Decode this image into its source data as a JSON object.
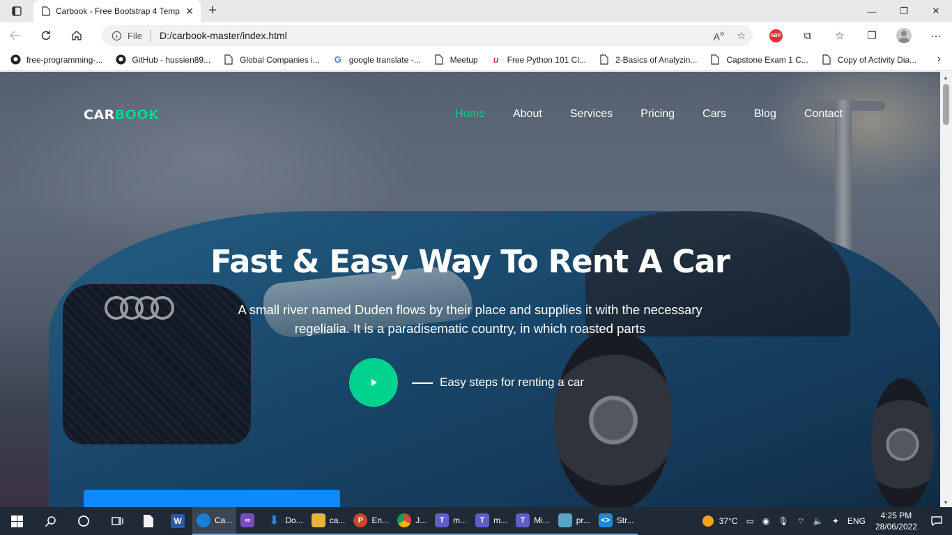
{
  "browser": {
    "tab": {
      "title": "Carbook - Free Bootstrap 4 Temp",
      "close": "✕"
    },
    "new_tab": "+",
    "window_controls": {
      "minimize": "—",
      "maximize": "❐",
      "close": "✕"
    },
    "address": {
      "scheme_label": "File",
      "url": "D:/carbook-master/index.html"
    },
    "bookmarks": [
      {
        "label": "free-programming-...",
        "icon": "github-icon"
      },
      {
        "label": "GitHub - hussien89...",
        "icon": "github-icon"
      },
      {
        "label": "Global Companies i...",
        "icon": "page-icon"
      },
      {
        "label": "google translate -...",
        "icon": "google-icon"
      },
      {
        "label": "Meetup",
        "icon": "page-icon"
      },
      {
        "label": "Free Python 101 Cl...",
        "icon": "udemy-icon"
      },
      {
        "label": "2-Basics of Analyzin...",
        "icon": "page-icon"
      },
      {
        "label": "Capstone Exam 1 C...",
        "icon": "page-icon"
      },
      {
        "label": "Copy of Activity Dia...",
        "icon": "page-icon"
      }
    ]
  },
  "site": {
    "logo": {
      "part1": "CAR",
      "part2": "BOOK"
    },
    "menu": [
      "Home",
      "About",
      "Services",
      "Pricing",
      "Cars",
      "Blog",
      "Contact"
    ],
    "active_menu": "Home",
    "hero": {
      "title": "Fast & Easy Way To Rent A Car",
      "text": "A small river named Duden flows by their place and supplies it with the necessary regelialia. It is a paradisematic country, in which roasted parts",
      "steps_label": "Easy steps for renting a car"
    },
    "colors": {
      "accent": "#01d28e",
      "booking_bar": "#1089ff"
    }
  },
  "taskbar": {
    "apps": [
      {
        "label": "Ca...",
        "icon": "edge-icon",
        "color": "#1c7fd6",
        "active": true
      },
      {
        "label": "",
        "icon": "visual-studio-icon",
        "color": "#7b4bbd",
        "active": false
      },
      {
        "label": "Do...",
        "icon": "download-icon",
        "color": "#2a8ad8",
        "active": false
      },
      {
        "label": "ca...",
        "icon": "folder-icon",
        "color": "#e7b53b",
        "active": false
      },
      {
        "label": "En...",
        "icon": "powerpoint-icon",
        "color": "#c8472b",
        "active": false
      },
      {
        "label": "J...",
        "icon": "chrome-icon",
        "color": "#e0a100",
        "active": false
      },
      {
        "label": "m...",
        "icon": "teams-icon",
        "color": "#5b5fc7",
        "active": false
      },
      {
        "label": "m...",
        "icon": "teams-icon",
        "color": "#5b5fc7",
        "active": false
      },
      {
        "label": "Mi...",
        "icon": "teams-icon",
        "color": "#5b5fc7",
        "active": false
      },
      {
        "label": "pr...",
        "icon": "notepad-icon",
        "color": "#5aa3c8",
        "active": false
      },
      {
        "label": "Str...",
        "icon": "vscode-icon",
        "color": "#1f8ad2",
        "active": false
      }
    ],
    "weather": "37°C",
    "language": "ENG",
    "time": "4:25 PM",
    "date": "28/06/2022"
  }
}
